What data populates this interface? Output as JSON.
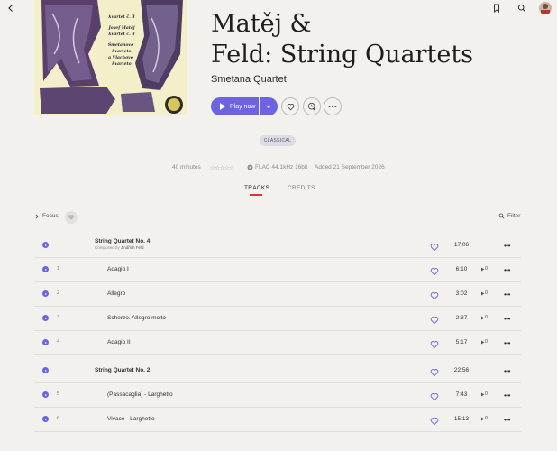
{
  "album": {
    "title": "Matěj &\nFeld: String Quartets",
    "artist": "Smetana Quartet",
    "play_label": "Play now",
    "genre": "CLASSICAL",
    "duration": "40 minutes",
    "rating_stars": "☆☆☆☆☆",
    "format": "FLAC 44.1kHz 16bit",
    "added": "Added 21 September 2026",
    "cover_text": [
      "kvartet č. 3",
      "Josef Matěj",
      "kvartet č. 3",
      "Smetanovo",
      "kvarteto",
      "a Vlachovo",
      "kvarteto"
    ]
  },
  "tabs": {
    "tracks": "TRACKS",
    "credits": "CREDITS"
  },
  "toolbar": {
    "focus": "Focus",
    "filter": "Filter"
  },
  "works": [
    {
      "title": "String Quartet No. 4",
      "composer_prefix": "Composed by",
      "composer": "Jindřich Feld",
      "duration": "17:06"
    },
    {
      "title": "String Quartet No. 2",
      "duration": "22:56"
    }
  ],
  "tracks": [
    {
      "num": "1",
      "title": "Adagio I",
      "duration": "6:10",
      "plays": "0"
    },
    {
      "num": "2",
      "title": "Allegro",
      "duration": "3:02",
      "plays": "0"
    },
    {
      "num": "3",
      "title": "Scherzo. Allegro molto",
      "duration": "2:37",
      "plays": "0"
    },
    {
      "num": "4",
      "title": "Adagio II",
      "duration": "5:17",
      "plays": "0"
    },
    {
      "num": "5",
      "title": "(Passacaglia) - Larghetto",
      "duration": "7:43",
      "plays": "0"
    },
    {
      "num": "6",
      "title": "Vivace - Larghetto",
      "duration": "15:13",
      "plays": "0"
    }
  ],
  "colors": {
    "accent": "#6c63e0",
    "tab_underline": "#d23b3b",
    "background": "#f2f1ee"
  }
}
